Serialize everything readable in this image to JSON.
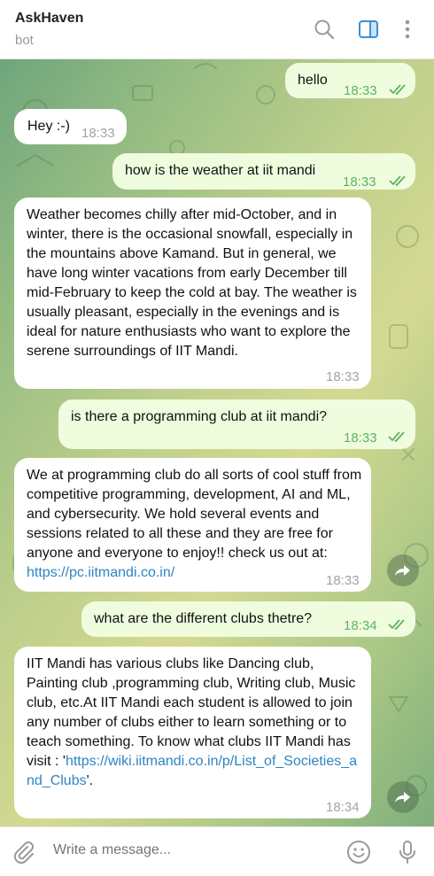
{
  "header": {
    "title": "AskHaven",
    "subtitle": "bot"
  },
  "messages": [
    {
      "dir": "out",
      "text": "hello",
      "time": "18:33"
    },
    {
      "dir": "in",
      "text": "Hey :-)",
      "time": "18:33"
    },
    {
      "dir": "out",
      "text": "how is the weather at iit mandi",
      "time": "18:33"
    },
    {
      "dir": "in",
      "text": "Weather becomes chilly after mid-October, and in winter, there is the occasional snowfall, especially in the mountains above Kamand. But in general, we have long winter vacations from early December till mid-February to keep the cold at bay. The weather is usually pleasant, especially in the evenings and is ideal for nature enthusiasts who want to explore the serene surroundings of IIT Mandi.",
      "time": "18:33"
    },
    {
      "dir": "out",
      "text": "is there a programming club at iit mandi?",
      "time": "18:33"
    },
    {
      "dir": "in",
      "text": "We at programming club do all sorts of cool stuff from competitive programming, development, AI and ML, and cybersecurity. We hold several events and sessions related to all these and they are free for anyone and everyone to enjoy!! check us out at: ",
      "link": "https://pc.iitmandi.co.in/",
      "time": "18:33"
    },
    {
      "dir": "out",
      "text": "what are the different clubs thetre?",
      "time": "18:34"
    },
    {
      "dir": "in",
      "text": "IIT Mandi has various clubs like Dancing club, Painting club ,programming club, Writing club, Music club, etc.At IIT Mandi each student is allowed to join any number of clubs either to learn something or to teach something. To know what clubs IIT Mandi has visit : '",
      "link": "https://wiki.iitmandi.co.in/p/List_of_Societies_and_Clubs",
      "text_after": "'.",
      "time": "18:34"
    }
  ],
  "composer": {
    "placeholder": "Write a message..."
  },
  "icons": {
    "search": "search-icon",
    "sidebar": "sidebar-toggle-icon",
    "menu": "more-vertical-icon",
    "attach": "paperclip-icon",
    "emoji": "emoji-icon",
    "mic": "microphone-icon",
    "forward": "forward-icon"
  },
  "colors": {
    "accent": "#3a8fd6",
    "outgoing_bubble": "#effdde",
    "incoming_bubble": "#ffffff",
    "time_out": "#5fb160",
    "link": "#2f84c3"
  }
}
